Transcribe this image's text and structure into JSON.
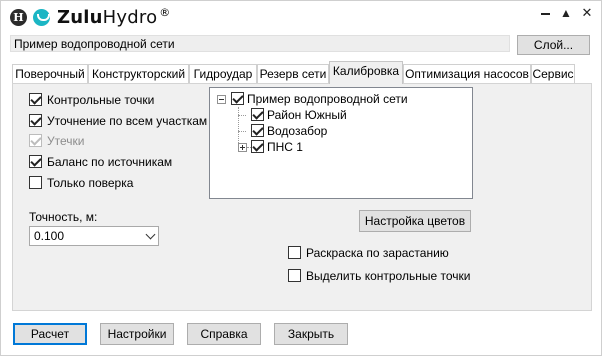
{
  "app": {
    "brand_part1": "Zulu",
    "brand_part2": "Hydro",
    "brand_mark": "®",
    "logo_letter": "H",
    "window_buttons": [
      "minimize-icon",
      "maximize-icon",
      "close-icon"
    ]
  },
  "header": {
    "network_name": "Пример водопроводной сети",
    "layer_button": "Слой..."
  },
  "tabs": [
    {
      "label": "Поверочный",
      "active": false
    },
    {
      "label": "Конструкторский",
      "active": false
    },
    {
      "label": "Гидроудар",
      "active": false
    },
    {
      "label": "Резерв сети",
      "active": false
    },
    {
      "label": "Калибровка",
      "active": true
    },
    {
      "label": "Оптимизация насосов",
      "active": false
    },
    {
      "label": "Сервис",
      "active": false
    }
  ],
  "calibration": {
    "options": [
      {
        "label": "Контрольные точки",
        "checked": true,
        "enabled": true
      },
      {
        "label": "Уточнение по всем участкам",
        "checked": true,
        "enabled": true
      },
      {
        "label": "Утечки",
        "checked": true,
        "enabled": false
      },
      {
        "label": "Баланс по источникам",
        "checked": true,
        "enabled": true
      },
      {
        "label": "Только поверка",
        "checked": false,
        "enabled": true
      }
    ],
    "accuracy_label": "Точность, м:",
    "accuracy_value": "0.100",
    "tree": {
      "root": {
        "label": "Пример водопроводной сети",
        "checked": true,
        "expanded": true
      },
      "children": [
        {
          "label": "Район Южный",
          "checked": true,
          "has_children": false
        },
        {
          "label": "Водозабор",
          "checked": true,
          "has_children": false
        },
        {
          "label": "ПНС 1",
          "checked": true,
          "has_children": true,
          "expanded": false
        }
      ]
    },
    "colors_button": "Настройка цветов",
    "coloring_options": [
      {
        "label": "Раскраска по зарастанию",
        "checked": false
      },
      {
        "label": "Выделить контрольные точки",
        "checked": false
      }
    ]
  },
  "footer": {
    "calculate": "Расчет",
    "settings": "Настройки",
    "help": "Справка",
    "close": "Закрыть"
  },
  "colors": {
    "panel_bg": "#f0f0f0",
    "default_button_border": "#0078d7",
    "logo_accent": "#1bb6c4"
  }
}
